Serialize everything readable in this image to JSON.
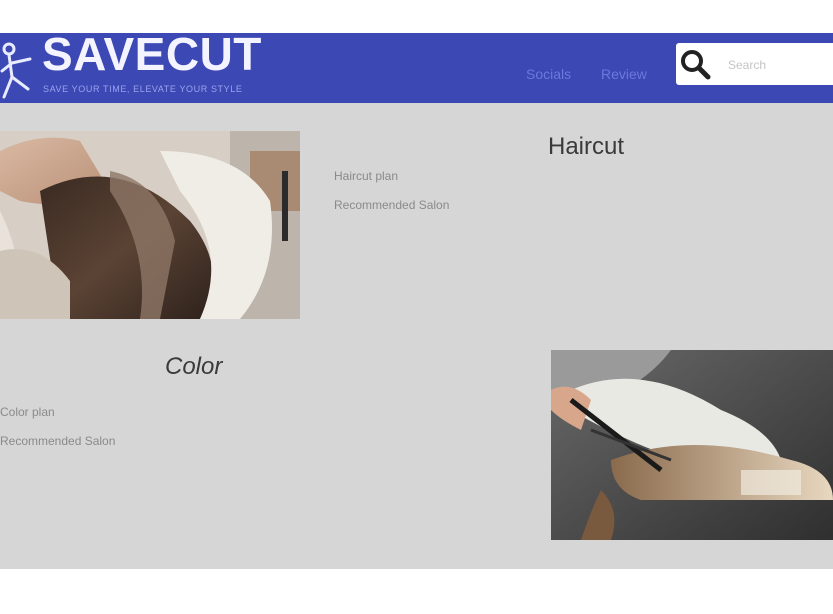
{
  "header": {
    "logo_title": "SAVECUT",
    "logo_tagline": "SAVE YOUR TIME, ELEVATE YOUR STYLE",
    "nav": [
      {
        "label": "Socials"
      },
      {
        "label": "Review"
      }
    ],
    "search": {
      "placeholder": "Search"
    }
  },
  "sections": {
    "haircut": {
      "title": "Haircut",
      "links": [
        "Haircut plan",
        "Recommended Salon"
      ]
    },
    "color": {
      "title": "Color",
      "links": [
        "Color plan",
        "Recommended Salon"
      ]
    }
  },
  "colors": {
    "header_bg": "#3c48b3",
    "page_bg": "#d6d6d6",
    "nav_text": "#6c78dd"
  }
}
